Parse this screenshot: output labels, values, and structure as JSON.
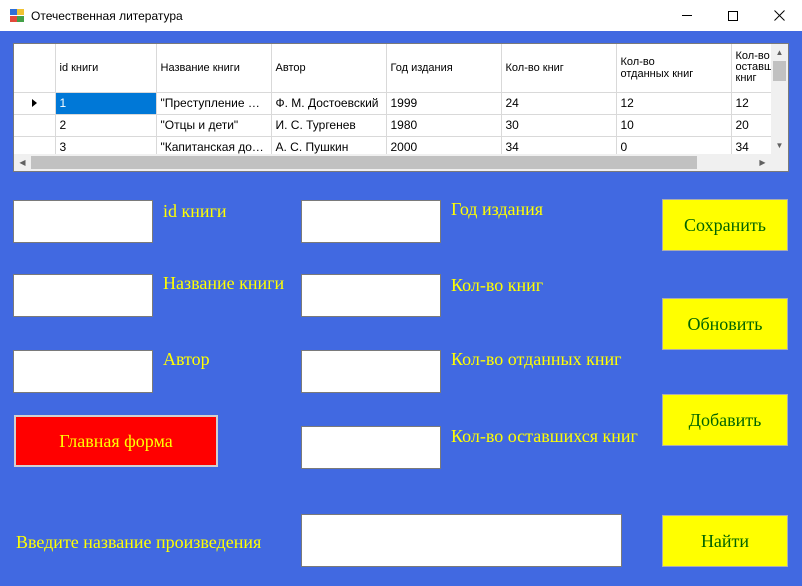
{
  "window": {
    "title": "Отечественная литература",
    "controls": [
      "minimize-icon",
      "maximize-icon",
      "close-icon"
    ]
  },
  "grid": {
    "columns": [
      "id книги",
      "Название книги",
      "Автор",
      "Год издания",
      "Кол-во книг",
      "Кол-во отданных книг",
      "Кол-во оставшихся книг"
    ],
    "header_display": [
      "id книги",
      "Название книги",
      "Автор",
      "Год издания",
      "Кол-во книг",
      "Кол-во\nотданных книг",
      "Кол-во\nоставш\nкниг"
    ],
    "rows": [
      [
        "1",
        "\"Преступление и н…",
        "Ф. М. Достоевский",
        "1999",
        "24",
        "12",
        "12"
      ],
      [
        "2",
        "\"Отцы и дети\"",
        "И. С. Тургенев",
        "1980",
        "30",
        "10",
        "20"
      ],
      [
        "3",
        "\"Капитанская дочк…",
        "А. С. Пушкин",
        "2000",
        "34",
        "0",
        "34"
      ]
    ],
    "selected_row": 0
  },
  "form": {
    "id_label": "id книги",
    "id_value": "",
    "title_label": "Название книги",
    "title_value": "",
    "author_label": "Автор",
    "author_value": "",
    "year_label": "Год издания",
    "year_value": "",
    "count_label": "Кол-во книг",
    "count_value": "",
    "given_label": "Кол-во отданных книг",
    "given_value": "",
    "left_label": "Кол-во оставшихся книг",
    "left_value": "",
    "search_label": "Введите название произведения",
    "search_value": ""
  },
  "buttons": {
    "save": "Сохранить",
    "refresh": "Обновить",
    "add": "Добавить",
    "find": "Найти",
    "main_form": "Главная форма"
  },
  "colors": {
    "background": "#4169e1",
    "label_text": "#ffff00",
    "action_button": "#ffff00",
    "action_button_text": "#006400",
    "main_form_button": "#ff0000",
    "selection": "#0078d7"
  }
}
